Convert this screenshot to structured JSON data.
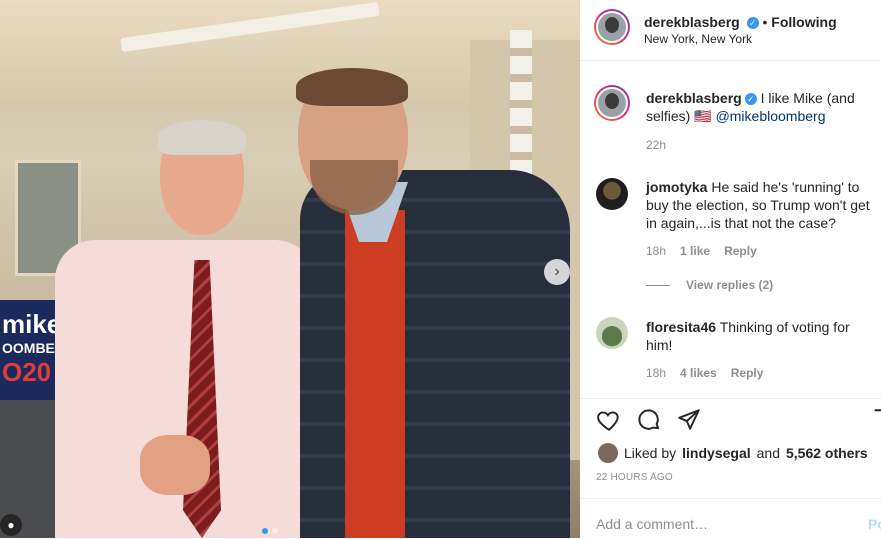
{
  "post": {
    "username": "derekblasberg",
    "follow_status": "Following",
    "location": "New York, New York",
    "caption_text": "I like Mike (and selfies) 🇺🇸",
    "caption_mention": "@mikebloomberg",
    "caption_time": "22h"
  },
  "photo": {
    "banner_line1": "mike",
    "banner_line2": "OOMBERG",
    "banner_line3": "O20",
    "next_arrow": "›"
  },
  "comments": [
    {
      "username": "jomotyka",
      "text": "He said he's 'running' to buy the election, so Trump won't get in again,...is that not the case?",
      "time": "18h",
      "likes": "1 like",
      "reply": "Reply"
    },
    {
      "username": "floresita46",
      "text": "Thinking of voting for him!",
      "time": "18h",
      "likes": "4 likes",
      "reply": "Reply"
    }
  ],
  "view_replies": "View replies (2)",
  "likes_line": {
    "prefix": "Liked by",
    "user": "lindysegal",
    "and": "and",
    "others": "5,562 others"
  },
  "posted_ago": "22 HOURS AGO",
  "add_comment": {
    "placeholder": "Add a comment…",
    "post_label": "Po"
  },
  "colors": {
    "link": "#00376b",
    "verified": "#3897f0",
    "muted": "#8e8e8e"
  }
}
